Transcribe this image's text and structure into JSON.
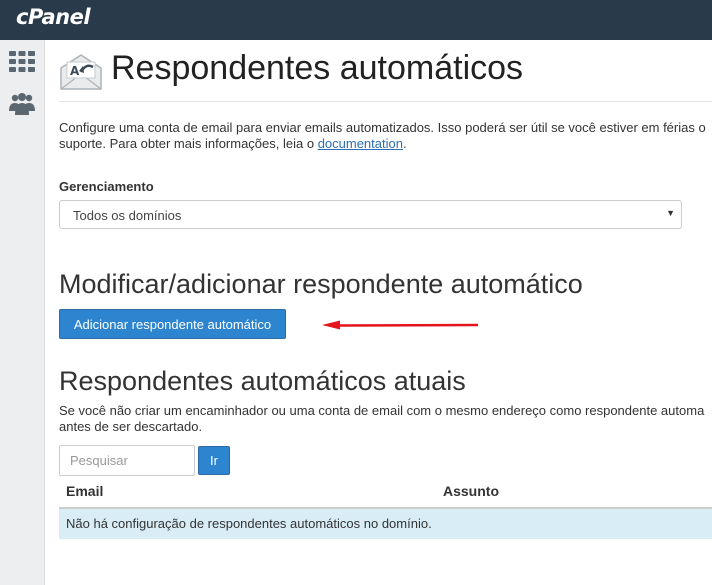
{
  "app": {
    "logo": "cPanel"
  },
  "sidebar": {
    "items": [
      {
        "icon": "apps-grid-icon"
      },
      {
        "icon": "users-icon"
      }
    ]
  },
  "header": {
    "title": "Respondentes automáticos",
    "icon": "autoresponder-envelope-icon"
  },
  "description": {
    "line1": "Configure uma conta de email para enviar emails automatizados. Isso poderá ser útil se você estiver em férias o",
    "line2_before": "suporte. Para obter mais informações, leia o ",
    "link": "documentation",
    "line2_after": "."
  },
  "management": {
    "label": "Gerenciamento",
    "selected": "Todos os domínios"
  },
  "modify": {
    "heading": "Modificar/adicionar respondente automático",
    "button_label": "Adicionar respondente automático",
    "annotation_color": "#e3141b"
  },
  "current": {
    "heading": "Respondentes automáticos atuais",
    "desc_line1": "Se você não criar um encaminhador ou uma conta de email com o mesmo endereço como respondente automa",
    "desc_line2": "antes de ser descartado.",
    "search_placeholder": "Pesquisar",
    "go_label": "Ir",
    "columns": [
      "Email",
      "Assunto"
    ],
    "empty_message": "Não há configuração de respondentes automáticos no domínio."
  },
  "colors": {
    "accent": "#2e85cf",
    "topbar": "#293a4a",
    "empty_row": "#d9edf7"
  }
}
